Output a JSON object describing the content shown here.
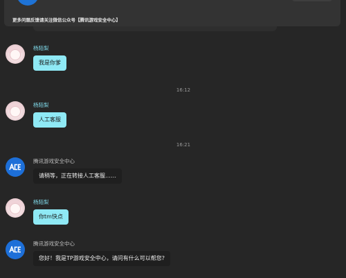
{
  "header": {
    "notice": "更多问题反馈请关注微信公众号【腾讯游戏安全中心】"
  },
  "messages": [
    {
      "sender": "杨陌梨",
      "text": "我是你爹"
    },
    {
      "sender": "杨陌梨",
      "text": "人工客服"
    },
    {
      "sender": "腾讯游戏安全中心",
      "text": "请稍等，正在转接人工客服……"
    },
    {
      "sender": "杨陌梨",
      "text": "你tm快点"
    },
    {
      "sender": "腾讯游戏安全中心",
      "text": "您好！我是TP游戏安全中心，请问有什么可以帮您?"
    }
  ],
  "times": [
    "16:12",
    "16:21"
  ],
  "avatars": {
    "user": "anime-avatar",
    "system": "ace-logo-icon"
  },
  "colors": {
    "background": "#262626",
    "user_bubble": "#8fe9f5",
    "system_bubble": "#1f1f1f",
    "user_name": "#7ed6e6",
    "brand_blue": "#1d6fd8"
  }
}
